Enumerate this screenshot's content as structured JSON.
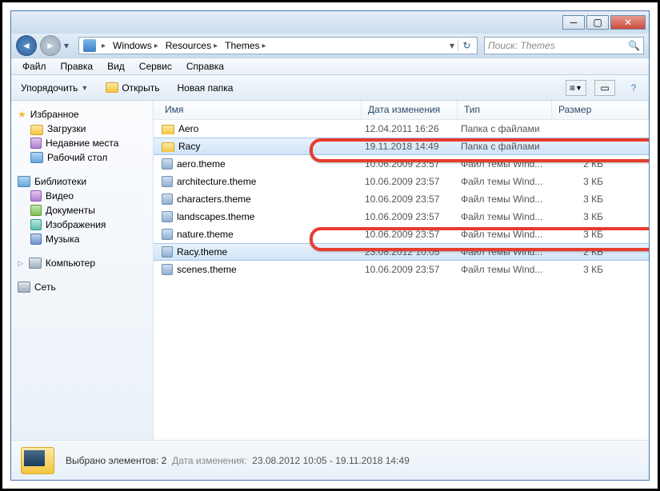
{
  "breadcrumbs": [
    "Windows",
    "Resources",
    "Themes"
  ],
  "search_placeholder": "Поиск: Themes",
  "menus": {
    "file": "Файл",
    "edit": "Правка",
    "view": "Вид",
    "tools": "Сервис",
    "help": "Справка"
  },
  "toolbar": {
    "organize": "Упорядочить",
    "open": "Открыть",
    "newfolder": "Новая папка"
  },
  "sidebar": {
    "favorites": "Избранное",
    "downloads": "Загрузки",
    "recent": "Недавние места",
    "desktop": "Рабочий стол",
    "libraries": "Библиотеки",
    "videos": "Видео",
    "documents": "Документы",
    "pictures": "Изображения",
    "music": "Музыка",
    "computer": "Компьютер",
    "network": "Сеть"
  },
  "columns": {
    "name": "Имя",
    "date": "Дата изменения",
    "type": "Тип",
    "size": "Размер"
  },
  "rows": [
    {
      "name": "Aero",
      "date": "12.04.2011 16:26",
      "type": "Папка с файлами",
      "size": "",
      "icon": "folder",
      "sel": false
    },
    {
      "name": "Racy",
      "date": "19.11.2018 14:49",
      "type": "Папка с файлами",
      "size": "",
      "icon": "folder",
      "sel": true
    },
    {
      "name": "aero.theme",
      "date": "10.06.2009 23:57",
      "type": "Файл темы Wind...",
      "size": "2 КБ",
      "icon": "theme",
      "sel": false
    },
    {
      "name": "architecture.theme",
      "date": "10.06.2009 23:57",
      "type": "Файл темы Wind...",
      "size": "3 КБ",
      "icon": "theme",
      "sel": false
    },
    {
      "name": "characters.theme",
      "date": "10.06.2009 23:57",
      "type": "Файл темы Wind...",
      "size": "3 КБ",
      "icon": "theme",
      "sel": false
    },
    {
      "name": "landscapes.theme",
      "date": "10.06.2009 23:57",
      "type": "Файл темы Wind...",
      "size": "3 КБ",
      "icon": "theme",
      "sel": false
    },
    {
      "name": "nature.theme",
      "date": "10.06.2009 23:57",
      "type": "Файл темы Wind...",
      "size": "3 КБ",
      "icon": "theme",
      "sel": false
    },
    {
      "name": "Racy.theme",
      "date": "23.08.2012 10:05",
      "type": "Файл темы Wind...",
      "size": "2 КБ",
      "icon": "theme",
      "sel": true
    },
    {
      "name": "scenes.theme",
      "date": "10.06.2009 23:57",
      "type": "Файл темы Wind...",
      "size": "3 КБ",
      "icon": "theme",
      "sel": false
    }
  ],
  "status": {
    "selected": "Выбрано элементов: 2",
    "date_label": "Дата изменения:",
    "date_value": "23.08.2012 10:05 - 19.11.2018 14:49"
  }
}
